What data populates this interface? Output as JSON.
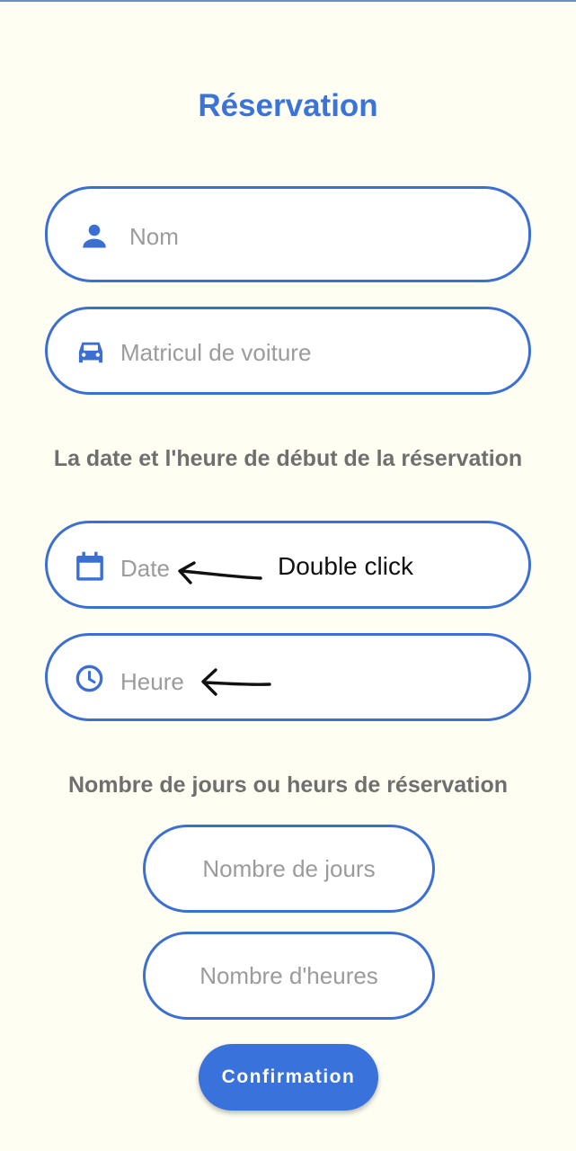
{
  "page": {
    "title": "Réservation",
    "accent_color": "#3b6fd3",
    "background_color": "#fffef3"
  },
  "fields": {
    "name": {
      "placeholder": "Nom",
      "icon": "person-icon"
    },
    "car_plate": {
      "placeholder": "Matricul de voiture",
      "icon": "car-icon"
    },
    "date": {
      "placeholder": "Date",
      "icon": "calendar-icon"
    },
    "time": {
      "placeholder": "Heure",
      "icon": "clock-icon"
    },
    "days": {
      "placeholder": "Nombre de jours"
    },
    "hours": {
      "placeholder": "Nombre d'heures"
    }
  },
  "sections": {
    "start_label": "La date et l'heure de début de la réservation",
    "duration_label": "Nombre de jours ou heurs de réservation"
  },
  "actions": {
    "confirm_label": "Confirmation"
  },
  "annotation": {
    "text": "Double click"
  }
}
